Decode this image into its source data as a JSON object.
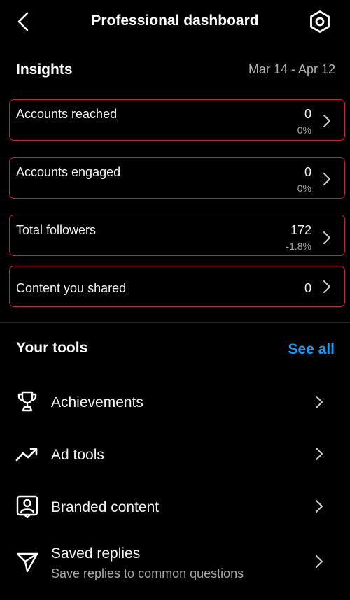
{
  "header": {
    "title": "Professional dashboard"
  },
  "insights": {
    "title": "Insights",
    "date_range": "Mar 14 - Apr 12",
    "cards": [
      {
        "label": "Accounts reached",
        "value": "0",
        "change": "0%"
      },
      {
        "label": "Accounts engaged",
        "value": "0",
        "change": "0%"
      },
      {
        "label": "Total followers",
        "value": "172",
        "change": "-1.8%"
      },
      {
        "label": "Content you shared",
        "value": "0"
      }
    ]
  },
  "tools": {
    "title": "Your tools",
    "see_all": "See all",
    "items": [
      {
        "icon": "trophy-icon",
        "label": "Achievements"
      },
      {
        "icon": "trending-up-icon",
        "label": "Ad tools"
      },
      {
        "icon": "branded-content-icon",
        "label": "Branded content"
      },
      {
        "icon": "send-icon",
        "label": "Saved replies",
        "subtitle": "Save replies to common questions"
      }
    ]
  },
  "colors": {
    "background": "#000000",
    "card_border": "#d0202b",
    "link": "#1d9bf0",
    "muted": "#a8a8a8"
  }
}
